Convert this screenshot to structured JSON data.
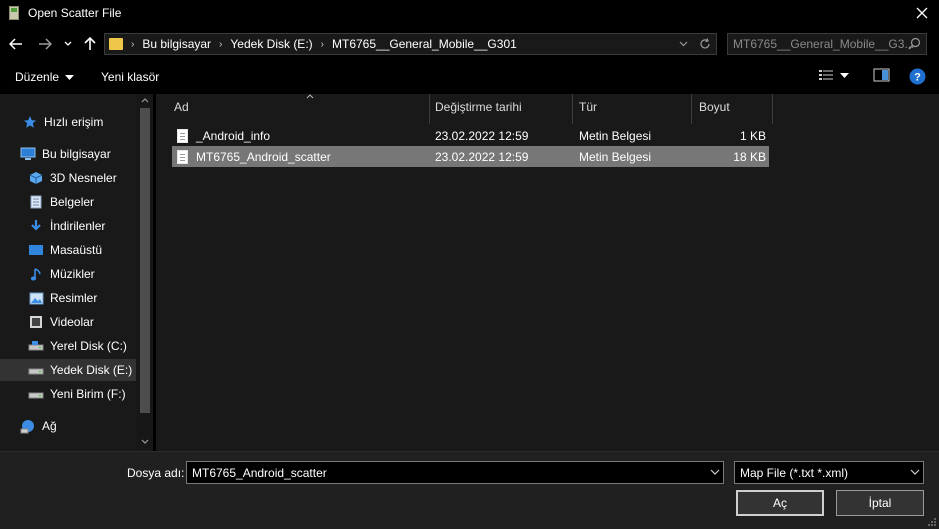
{
  "window": {
    "title": "Open Scatter File",
    "close_glyph": "✕"
  },
  "address": {
    "back_glyph": "←",
    "forward_glyph": "→",
    "recent_glyph": "⌄",
    "up_glyph": "↑",
    "breadcrumbs": [
      "Bu bilgisayar",
      "Yedek Disk (E:)",
      "MT6765__General_Mobile__G301"
    ],
    "separator": "›",
    "refresh_glyph": "↻",
    "dropdown_glyph": "⌄"
  },
  "search": {
    "placeholder": "MT6765__General_Mobile__G3..."
  },
  "toolbar": {
    "organize_label": "Düzenle",
    "new_folder_label": "Yeni klasör",
    "help_glyph": "?"
  },
  "nav": {
    "items": [
      {
        "label": "Hızlı erişim",
        "icon": "star-icon"
      },
      {
        "label": "Bu bilgisayar",
        "icon": "computer-icon"
      },
      {
        "label": "3D Nesneler",
        "icon": "cube-icon"
      },
      {
        "label": "Belgeler",
        "icon": "documents-icon"
      },
      {
        "label": "İndirilenler",
        "icon": "download-icon"
      },
      {
        "label": "Masaüstü",
        "icon": "desktop-icon"
      },
      {
        "label": "Müzikler",
        "icon": "music-icon"
      },
      {
        "label": "Resimler",
        "icon": "pictures-icon"
      },
      {
        "label": "Videolar",
        "icon": "videos-icon"
      },
      {
        "label": "Yerel Disk (C:)",
        "icon": "drive-icon"
      },
      {
        "label": "Yedek Disk (E:)",
        "icon": "drive-icon"
      },
      {
        "label": "Yeni Birim (F:)",
        "icon": "drive-icon"
      },
      {
        "label": "Ağ",
        "icon": "network-icon"
      }
    ],
    "selected": "Yedek Disk (E:)"
  },
  "files": {
    "columns": [
      "Ad",
      "Değiştirme tarihi",
      "Tür",
      "Boyut"
    ],
    "rows": [
      {
        "name": "_Android_info",
        "modified": "23.02.2022 12:59",
        "type": "Metin Belgesi",
        "size": "1 KB"
      },
      {
        "name": "MT6765_Android_scatter",
        "modified": "23.02.2022 12:59",
        "type": "Metin Belgesi",
        "size": "18 KB"
      }
    ],
    "selected": "MT6765_Android_scatter"
  },
  "bottom": {
    "filename_label": "Dosya adı:",
    "filename_value": "MT6765_Android_scatter",
    "filetype_value": "Map File (*.txt *.xml)",
    "open_label": "Aç",
    "cancel_label": "İptal"
  },
  "colors": {
    "background": "#000000",
    "pane": "#191919",
    "selected_row": "#777777",
    "selected_nav": "#333333",
    "accent_blue": "#3a8ee6",
    "folder_yellow": "#f0c64a"
  }
}
